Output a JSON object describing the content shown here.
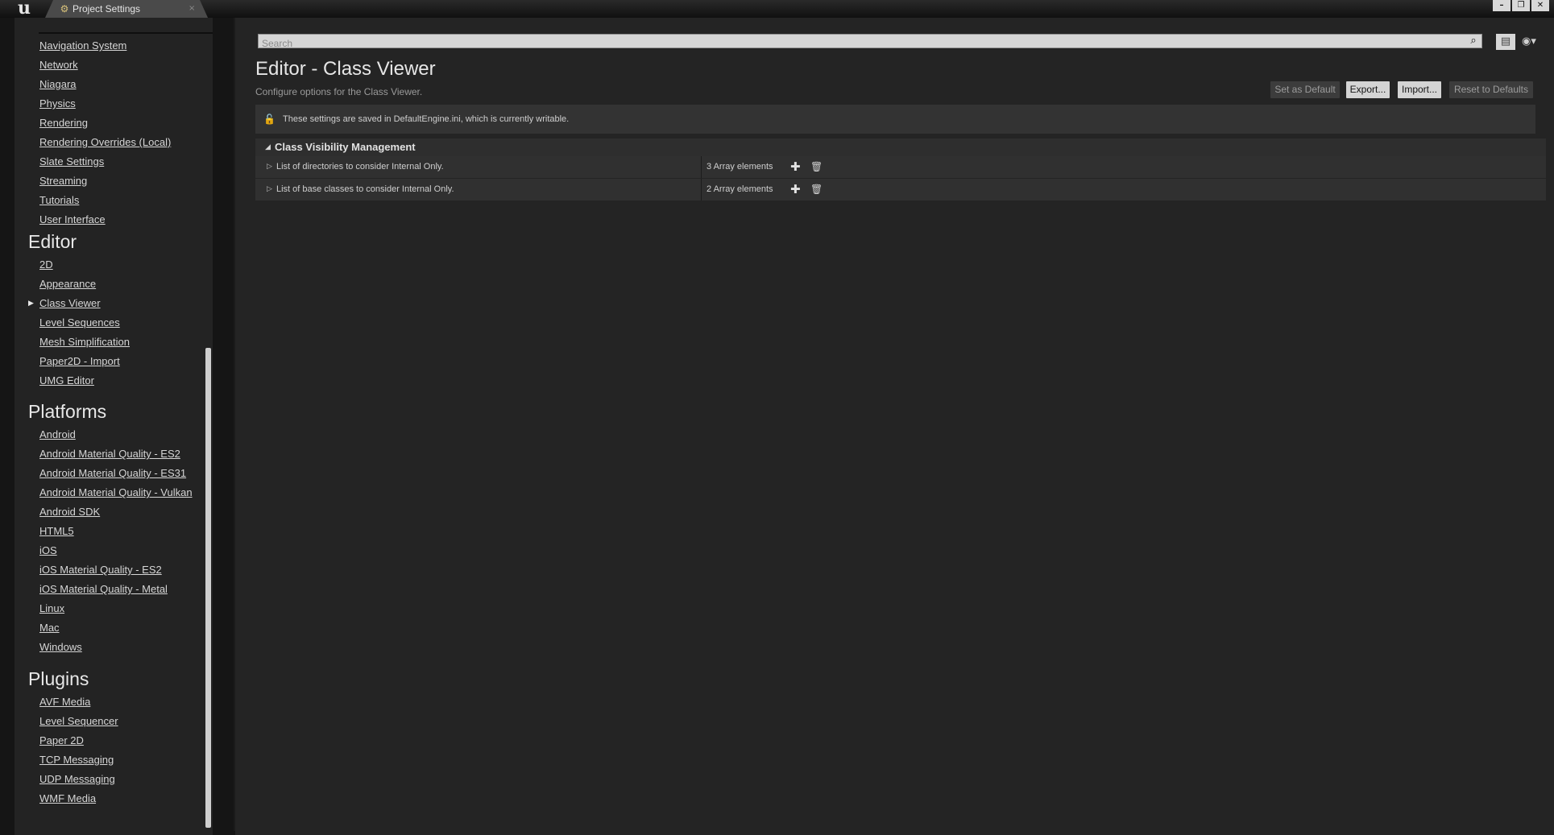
{
  "window": {
    "tab_title": "Project Settings",
    "tab_close": "×",
    "logo": "u",
    "buttons": [
      "–",
      "❐",
      "✕"
    ]
  },
  "sidebar": {
    "group_top_items": [
      "Navigation System",
      "Network",
      "Niagara",
      "Physics",
      "Rendering",
      "Rendering Overrides (Local)",
      "Slate Settings",
      "Streaming",
      "Tutorials",
      "User Interface"
    ],
    "sections": [
      {
        "heading": "Editor",
        "items": [
          "2D",
          "Appearance",
          "Class Viewer",
          "Level Sequences",
          "Mesh Simplification",
          "Paper2D - Import",
          "UMG Editor"
        ]
      },
      {
        "heading": "Platforms",
        "items": [
          "Android",
          "Android Material Quality - ES2",
          "Android Material Quality - ES31",
          "Android Material Quality - Vulkan",
          "Android SDK",
          "HTML5",
          "iOS",
          "iOS Material Quality - ES2",
          "iOS Material Quality - Metal",
          "Linux",
          "Mac",
          "Windows"
        ]
      },
      {
        "heading": "Plugins",
        "items": [
          "AVF Media",
          "Level Sequencer",
          "Paper 2D",
          "TCP Messaging",
          "UDP Messaging",
          "WMF Media"
        ]
      }
    ],
    "selected": "Class Viewer"
  },
  "main": {
    "search_placeholder": "Search",
    "title": "Editor - Class Viewer",
    "description": "Configure options for the Class Viewer.",
    "actions": {
      "set_default": "Set as Default",
      "export": "Export...",
      "import": "Import...",
      "reset": "Reset to Defaults"
    },
    "notice": "These settings are saved in DefaultEngine.ini, which is currently writable.",
    "category": {
      "title": "Class Visibility Management",
      "rows": [
        {
          "name": "List of directories to consider Internal Only.",
          "value": "3 Array elements"
        },
        {
          "name": "List of base classes to consider Internal Only.",
          "value": "2 Array elements"
        }
      ]
    }
  }
}
